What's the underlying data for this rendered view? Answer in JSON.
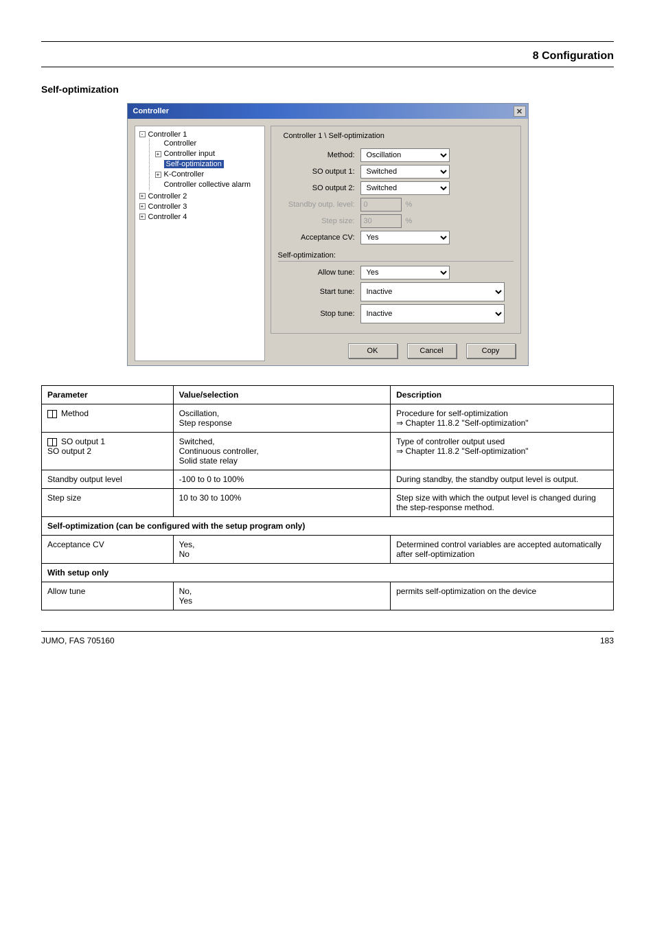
{
  "header": {
    "right": "8 Configuration"
  },
  "sectionHead": "Self-optimization",
  "win": {
    "title": "Controller",
    "close": "✕",
    "tree": {
      "c1": "Controller 1",
      "c1_controller": "Controller",
      "c1_input": "Controller input",
      "c1_self": "Self-optimization",
      "c1_k": "K-Controller",
      "c1_alarm": "Controller collective alarm",
      "c2": "Controller 2",
      "c3": "Controller 3",
      "c4": "Controller 4"
    },
    "form": {
      "crumb": "Controller 1 \\ Self-optimization",
      "method_lbl": "Method:",
      "method_val": "Oscillation",
      "so1_lbl": "SO output 1:",
      "so1_val": "Switched",
      "so2_lbl": "SO output 2:",
      "so2_val": "Switched",
      "standby_lbl": "Standby outp. level:",
      "standby_val": "0",
      "step_lbl": "Step size:",
      "step_val": "30",
      "unit": "%",
      "accept_lbl": "Acceptance CV:",
      "accept_val": "Yes",
      "sub": "Self-optimization:",
      "allow_lbl": "Allow tune:",
      "allow_val": "Yes",
      "start_lbl": "Start tune:",
      "start_val": "Inactive",
      "stop_lbl": "Stop tune:",
      "stop_val": "Inactive"
    },
    "footer": {
      "ok": "OK",
      "cancel": "Cancel",
      "copy": "Copy"
    }
  },
  "table": {
    "h1": "Parameter",
    "h2": "Value/selection",
    "h3": "Description",
    "rows": [
      {
        "label": "Method",
        "icon": true,
        "values": "Oscillation,\nStep response",
        "desc": "Procedure for self-optimization\n⇒ Chapter 11.8.2 \"Self-optimization\""
      },
      {
        "label": "SO output 1\nSO output 2",
        "icon": true,
        "values": "Switched,\nContinuous controller,\nSolid state relay",
        "desc": "Type of controller output used\n⇒ Chapter 11.8.2 \"Self-optimization\""
      },
      {
        "label": "Standby output level",
        "values": "-100 to 0 to 100%",
        "desc": "During standby, the standby output level is output."
      },
      {
        "label": "Step size",
        "values": "10 to 30 to 100%",
        "desc": "Step size with which the output level is changed during the step-response method."
      },
      {
        "type": "header",
        "text": "Self-optimization (can be configured with the setup program only)"
      },
      {
        "label": "Acceptance CV",
        "values": "Yes,\nNo",
        "desc": "Determined control variables are accepted automatically after self-optimization"
      },
      {
        "type": "header",
        "text": "With setup only"
      },
      {
        "label": "Allow tune",
        "values": "No,\nYes",
        "desc": "permits self-optimization on the device"
      }
    ]
  },
  "footer": {
    "left": "JUMO, FAS 705160",
    "right": "183"
  }
}
